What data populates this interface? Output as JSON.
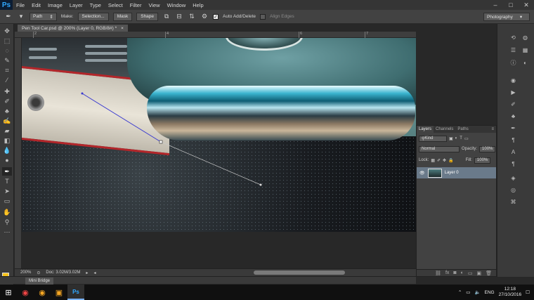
{
  "app": {
    "logo": "Ps",
    "menu": [
      "File",
      "Edit",
      "Image",
      "Layer",
      "Type",
      "Select",
      "Filter",
      "View",
      "Window",
      "Help"
    ],
    "window_controls": [
      "–",
      "□",
      "✕"
    ]
  },
  "options_bar": {
    "tool_icon": "pen-tool-icon",
    "mode_value": "Path",
    "make_label": "Make:",
    "selection_btn": "Selection...",
    "mask_btn": "Mask",
    "shape_btn": "Shape",
    "auto_add_delete_label": "Auto Add/Delete",
    "auto_add_delete_checked": true,
    "align_edges_label": "Align Edges",
    "align_edges_checked": false,
    "workspace_value": "Photography"
  },
  "document": {
    "tab_title": "Pen Tool Car.psd @ 200% (Layer 0, RGB/8#) *",
    "tab_close": "×",
    "ruler_marks": [
      "2",
      "4",
      "6",
      "7"
    ]
  },
  "status": {
    "zoom": "200%",
    "doc_info": "Doc: 3.02M/3.02M"
  },
  "mini_bridge": {
    "label": "Mini Bridge"
  },
  "layers_panel": {
    "tabs": [
      "Layers",
      "Channels",
      "Paths"
    ],
    "active_tab": "Layers",
    "filter_value": "Kind",
    "blend_mode": "Normal",
    "opacity_label": "Opacity:",
    "opacity_value": "100%",
    "lock_label": "Lock:",
    "fill_label": "Fill:",
    "fill_value": "100%",
    "layers": [
      {
        "name": "Layer 0",
        "visible": true,
        "selected": true
      }
    ]
  },
  "colors": {
    "foreground": "#f6c21a",
    "background": "#111111",
    "accent": "#31a8ff"
  },
  "taskbar": {
    "language": "ENG",
    "time": "12:18",
    "date": "27/10/2016"
  }
}
